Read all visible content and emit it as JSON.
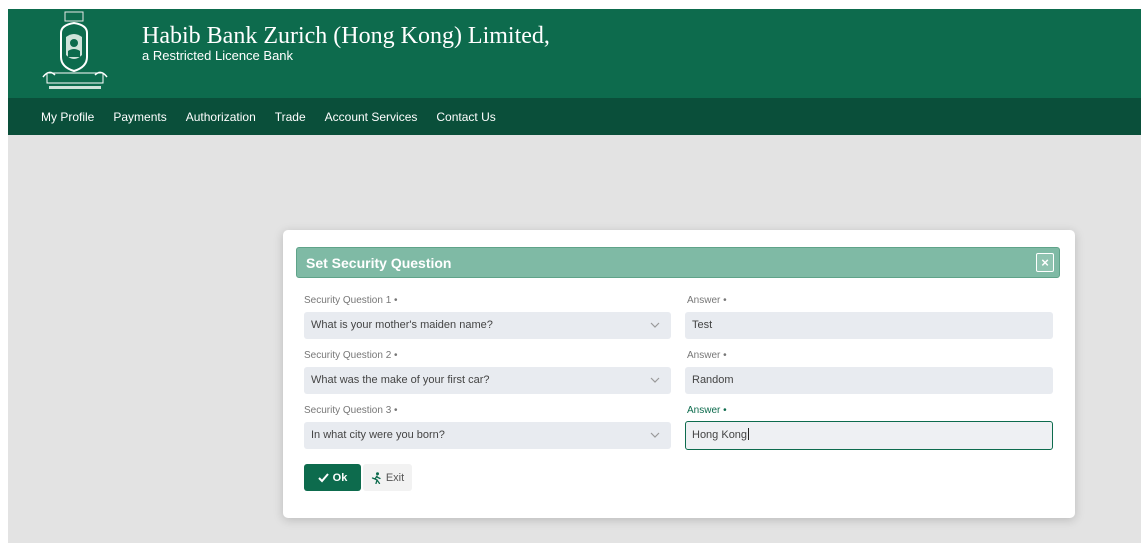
{
  "brand": {
    "name": "Habib Bank Zurich (Hong Kong) Limited,",
    "subtitle": "a Restricted Licence Bank",
    "primary_color": "#0d6b4d",
    "nav_color": "#0a4f3a",
    "logo_icon": "lion-crest-logo"
  },
  "nav": {
    "items": [
      "My Profile",
      "Payments",
      "Authorization",
      "Trade",
      "Account Services",
      "Contact Us"
    ]
  },
  "modal": {
    "title": "Set Security Question",
    "close_label": "×",
    "rows": [
      {
        "question_label": "Security Question 1 •",
        "question_value": "What is your mother's maiden name?",
        "answer_label": "Answer •",
        "answer_value": "Test"
      },
      {
        "question_label": "Security Question 2 •",
        "question_value": "What was the make of your first car?",
        "answer_label": "Answer •",
        "answer_value": "Random"
      },
      {
        "question_label": "Security Question 3 •",
        "question_value": "In what city were you born?",
        "answer_label": "Answer •",
        "answer_value": "Hong Kong"
      }
    ],
    "ok_label": "Ok",
    "exit_label": "Exit"
  }
}
